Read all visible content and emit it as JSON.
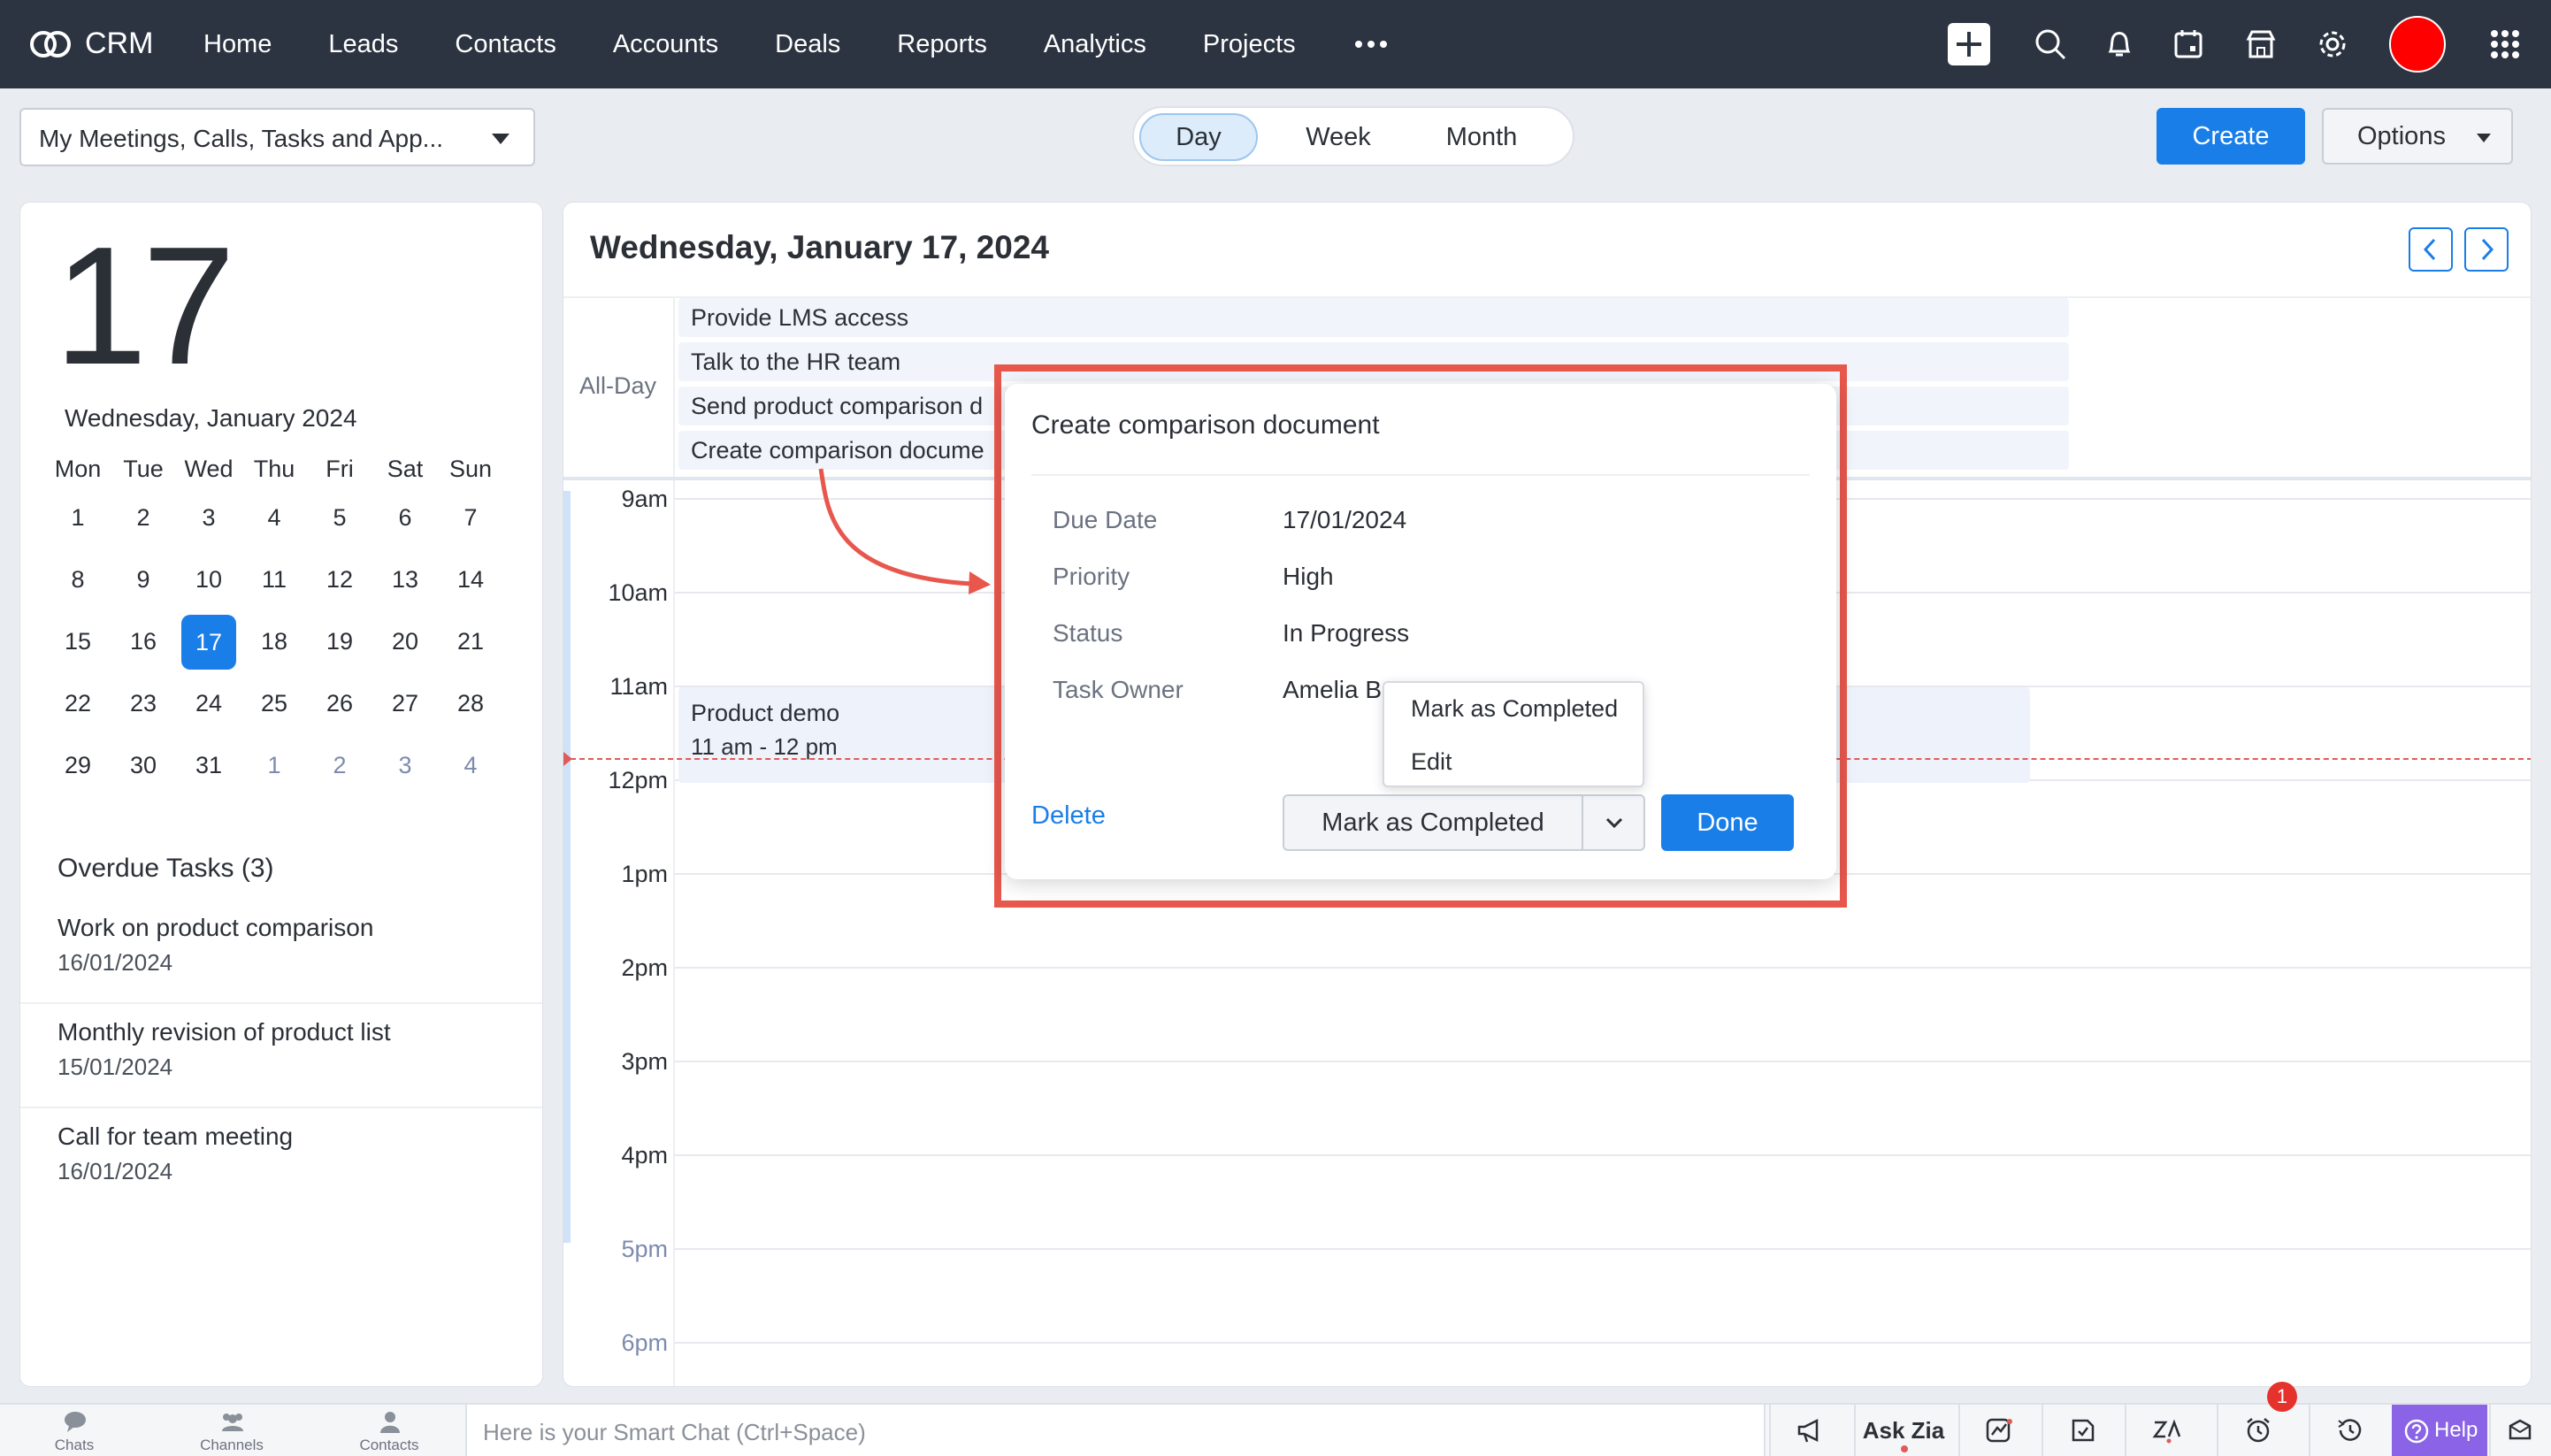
{
  "nav": {
    "brand": "CRM",
    "items": [
      "Home",
      "Leads",
      "Contacts",
      "Accounts",
      "Deals",
      "Reports",
      "Analytics",
      "Projects"
    ],
    "icons": [
      "more-icon",
      "add-icon",
      "search-icon",
      "bell-icon",
      "calendar-icon",
      "marketplace-icon",
      "gear-icon",
      "avatar",
      "apps-grid-icon"
    ],
    "avatar_color": "#ff0000"
  },
  "toolbar": {
    "view_select": "My Meetings, Calls, Tasks and App...",
    "segments": {
      "day": "Day",
      "week": "Week",
      "month": "Month"
    },
    "create": "Create",
    "options": "Options"
  },
  "left": {
    "big_date": "17",
    "month_label": "Wednesday, January 2024",
    "weekdays": [
      "Mon",
      "Tue",
      "Wed",
      "Thu",
      "Fri",
      "Sat",
      "Sun"
    ],
    "weeks": [
      [
        "1",
        "2",
        "3",
        "4",
        "5",
        "6",
        "7"
      ],
      [
        "8",
        "9",
        "10",
        "11",
        "12",
        "13",
        "14"
      ],
      [
        "15",
        "16",
        "17",
        "18",
        "19",
        "20",
        "21"
      ],
      [
        "22",
        "23",
        "24",
        "25",
        "26",
        "27",
        "28"
      ],
      [
        "29",
        "30",
        "31",
        "1",
        "2",
        "3",
        "4"
      ]
    ],
    "selected_day": "17",
    "overdue_title": "Overdue Tasks (3)",
    "overdue": [
      {
        "name": "Work on product comparison",
        "date": "16/01/2024"
      },
      {
        "name": "Monthly revision of product list",
        "date": "15/01/2024"
      },
      {
        "name": "Call for team meeting",
        "date": "16/01/2024"
      }
    ]
  },
  "calendar": {
    "title": "Wednesday, January 17, 2024",
    "allday_label": "All-Day",
    "allday_events": [
      "Provide LMS access",
      "Talk to the HR team",
      "Send product comparison d",
      "Create comparison docume"
    ],
    "hours": [
      "9am",
      "10am",
      "11am",
      "12pm",
      "1pm",
      "2pm",
      "3pm",
      "4pm",
      "5pm",
      "6pm"
    ],
    "event": {
      "title": "Product demo",
      "time": "11 am - 12 pm"
    }
  },
  "popup": {
    "title": "Create comparison document",
    "fields": [
      {
        "label": "Due Date",
        "value": "17/01/2024"
      },
      {
        "label": "Priority",
        "value": "High"
      },
      {
        "label": "Status",
        "value": "In Progress"
      },
      {
        "label": "Task Owner",
        "value": "Amelia B"
      }
    ],
    "delete": "Delete",
    "mark_completed": "Mark as Completed",
    "done": "Done",
    "menu": [
      "Mark as Completed",
      "Edit"
    ]
  },
  "bottom": {
    "tabs": [
      "Chats",
      "Channels",
      "Contacts"
    ],
    "smartchat_placeholder": "Here is your Smart Chat (Ctrl+Space)",
    "ask_zia": "Ask Zia",
    "badge": "1",
    "help": "Help"
  },
  "colors": {
    "accent": "#1a7ee8",
    "nav_bg": "#2d3441",
    "highlight": "#e8574c",
    "help": "#8a63e6"
  }
}
